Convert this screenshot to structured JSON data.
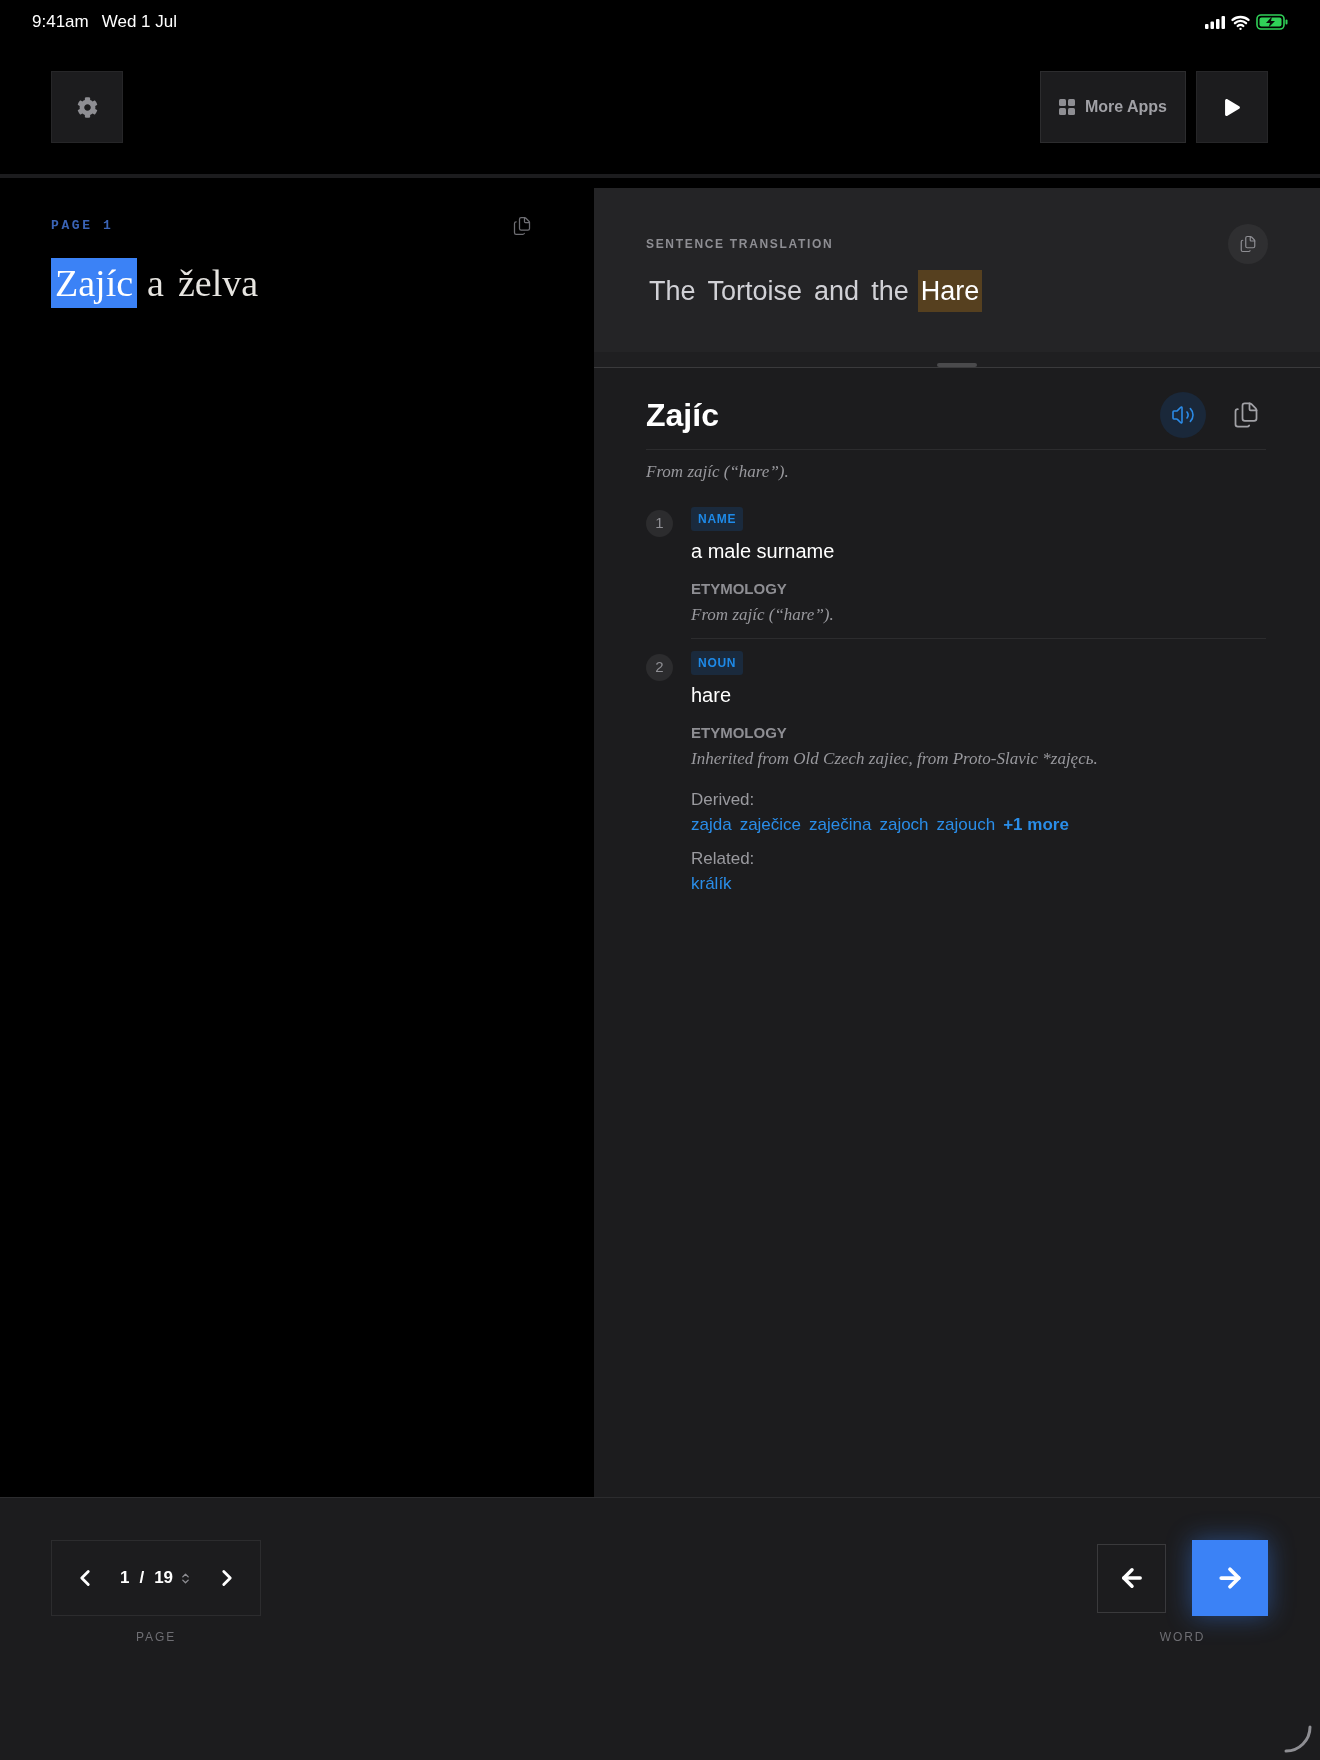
{
  "status_bar": {
    "time": "9:41am",
    "date": "Wed 1 Jul"
  },
  "toolbar": {
    "more_apps_label": "More Apps"
  },
  "page_panel": {
    "label": "PAGE 1",
    "words": [
      {
        "text": "Zajíc",
        "selected": true
      },
      {
        "text": "a",
        "selected": false
      },
      {
        "text": "želva",
        "selected": false
      }
    ]
  },
  "translation": {
    "label": "SENTENCE TRANSLATION",
    "words": [
      {
        "text": "The",
        "highlighted": false
      },
      {
        "text": "Tortoise",
        "highlighted": false
      },
      {
        "text": "and",
        "highlighted": false
      },
      {
        "text": "the",
        "highlighted": false
      },
      {
        "text": "Hare",
        "highlighted": true
      }
    ]
  },
  "entry": {
    "headword": "Zajíc",
    "etymology": "From zajíc (“hare”).",
    "senses": [
      {
        "number": "1",
        "part_of_speech": "NAME",
        "definition": "a male surname",
        "etymology_label": "ETYMOLOGY",
        "etymology": "From zajíc (“hare”)."
      },
      {
        "number": "2",
        "part_of_speech": "NOUN",
        "definition": "hare",
        "etymology_label": "ETYMOLOGY",
        "etymology": "Inherited from Old Czech zajiec, from Proto-Slavic *zajęcь.",
        "relations": [
          {
            "label": "Derived:",
            "words": [
              "zajda",
              "zaječice",
              "zaječina",
              "zajoch",
              "zajouch"
            ],
            "more": "+1 more"
          },
          {
            "label": "Related:",
            "words": [
              "králík"
            ]
          }
        ]
      }
    ]
  },
  "pager": {
    "current": "1",
    "separator": "/",
    "total": "19",
    "label": "PAGE"
  },
  "word_nav": {
    "label": "WORD"
  }
}
